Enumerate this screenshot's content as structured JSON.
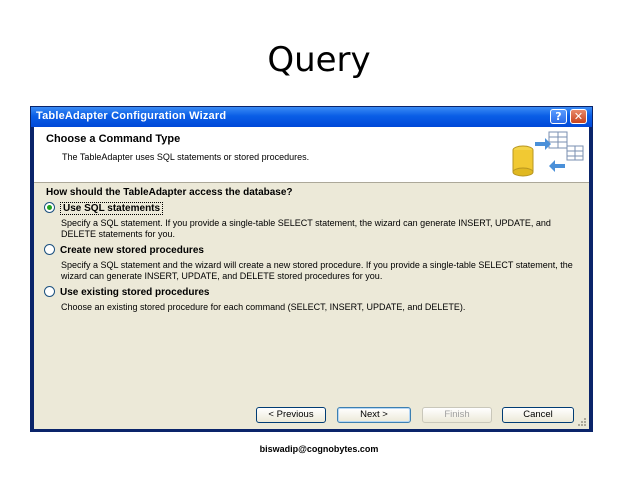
{
  "slide": {
    "title": "Query",
    "footer": "biswadip@cognobytes.com"
  },
  "window": {
    "title": "TableAdapter Configuration Wizard",
    "help_icon": "?",
    "close_icon": "✕"
  },
  "header": {
    "title": "Choose a Command Type",
    "subtitle": "The TableAdapter uses SQL statements or stored procedures.",
    "icon": "database-table-icon"
  },
  "question": "How should the TableAdapter access the database?",
  "options": [
    {
      "label": "Use SQL statements",
      "selected": true,
      "description": "Specify a SQL statement. If you provide a single-table SELECT statement, the wizard can generate INSERT, UPDATE, and DELETE statements for you."
    },
    {
      "label": "Create new stored procedures",
      "selected": false,
      "description": "Specify a SQL statement and the wizard will create a new stored procedure. If you provide a single-table SELECT statement, the wizard can generate INSERT, UPDATE, and DELETE stored procedures for you."
    },
    {
      "label": "Use existing stored procedures",
      "selected": false,
      "description": "Choose an existing stored procedure for each command (SELECT, INSERT, UPDATE, and DELETE)."
    }
  ],
  "buttons": {
    "previous": "< Previous",
    "next": "Next >",
    "finish": "Finish",
    "cancel": "Cancel"
  },
  "colors": {
    "titlebar": "#0a5ee6",
    "dialog_bg": "#ece9d8",
    "radio_dot": "#21a121"
  }
}
